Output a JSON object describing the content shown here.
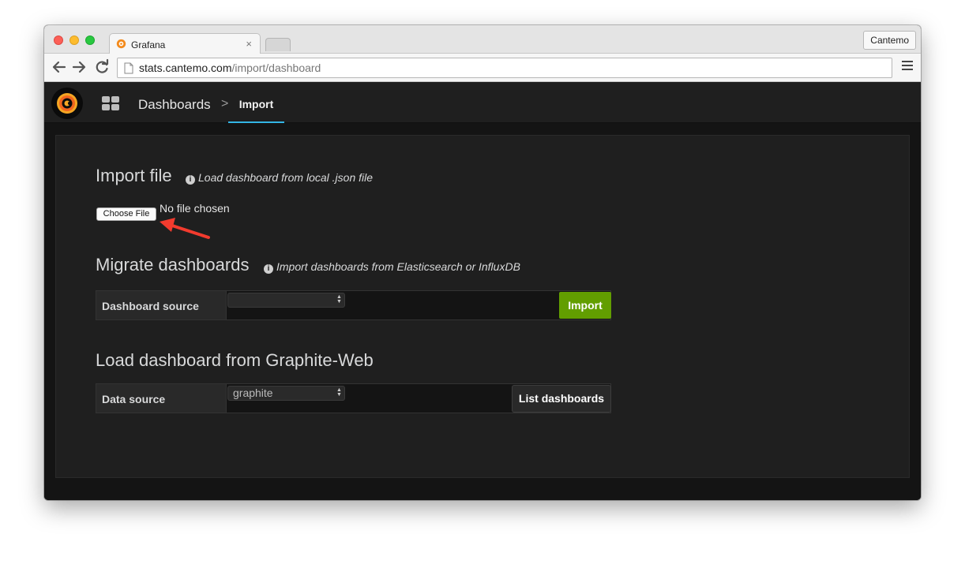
{
  "browser": {
    "tab_title": "Grafana",
    "tab_close": "×",
    "profile_name": "Cantemo",
    "url_host": "stats.cantemo.com",
    "url_path": "/import/dashboard"
  },
  "navbar": {
    "breadcrumb_dashboards": "Dashboards",
    "breadcrumb_separator": ">",
    "breadcrumb_current": "Import"
  },
  "import_file": {
    "title": "Import file",
    "hint": "Load dashboard from local .json file",
    "choose_file_label": "Choose File",
    "file_status": "No file chosen"
  },
  "migrate": {
    "title": "Migrate dashboards",
    "hint": "Import dashboards from Elasticsearch or InfluxDB",
    "source_label": "Dashboard source",
    "source_value": "",
    "import_label": "Import"
  },
  "graphite": {
    "title": "Load dashboard from Graphite-Web",
    "source_label": "Data source",
    "source_value": "graphite",
    "list_label": "List dashboards"
  },
  "colors": {
    "import_button": "#629e00",
    "active_tab_underline": "#33b5e5",
    "annotation_arrow": "#f23b2e"
  }
}
